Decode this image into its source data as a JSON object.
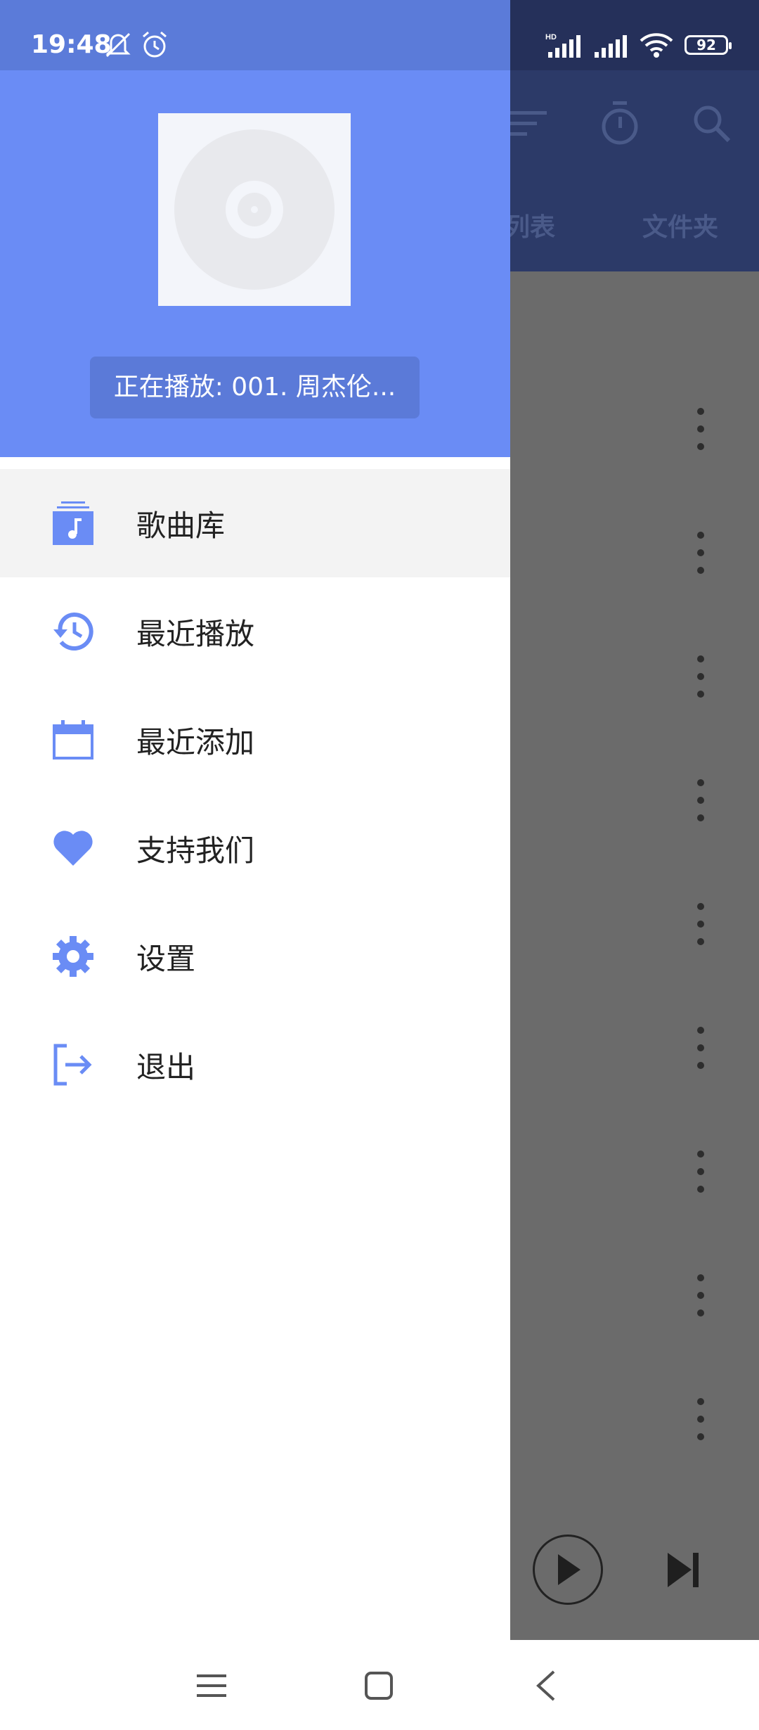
{
  "status_bar": {
    "time": "19:48",
    "battery": "92",
    "icons": [
      "bell-off-icon",
      "alarm-icon",
      "hd-signal-icon",
      "signal-icon",
      "wifi-icon",
      "battery-icon"
    ]
  },
  "background_app": {
    "tabs": [
      "列表",
      "文件夹"
    ],
    "toolbar_icons": [
      "sort-icon",
      "timer-icon",
      "search-icon"
    ],
    "row_count": 9
  },
  "drawer": {
    "now_playing": "正在播放: 001. 周杰伦...",
    "menu": [
      {
        "label": "歌曲库",
        "icon": "music-library-icon",
        "active": true
      },
      {
        "label": "最近播放",
        "icon": "history-icon",
        "active": false
      },
      {
        "label": "最近添加",
        "icon": "calendar-icon",
        "active": false
      },
      {
        "label": "支持我们",
        "icon": "heart-icon",
        "active": false
      },
      {
        "label": "设置",
        "icon": "gear-icon",
        "active": false
      },
      {
        "label": "退出",
        "icon": "exit-icon",
        "active": false
      }
    ]
  },
  "colors": {
    "accent": "#6a8cf5",
    "icon": "#6a8cf5",
    "active_bg": "#f3f3f3"
  }
}
